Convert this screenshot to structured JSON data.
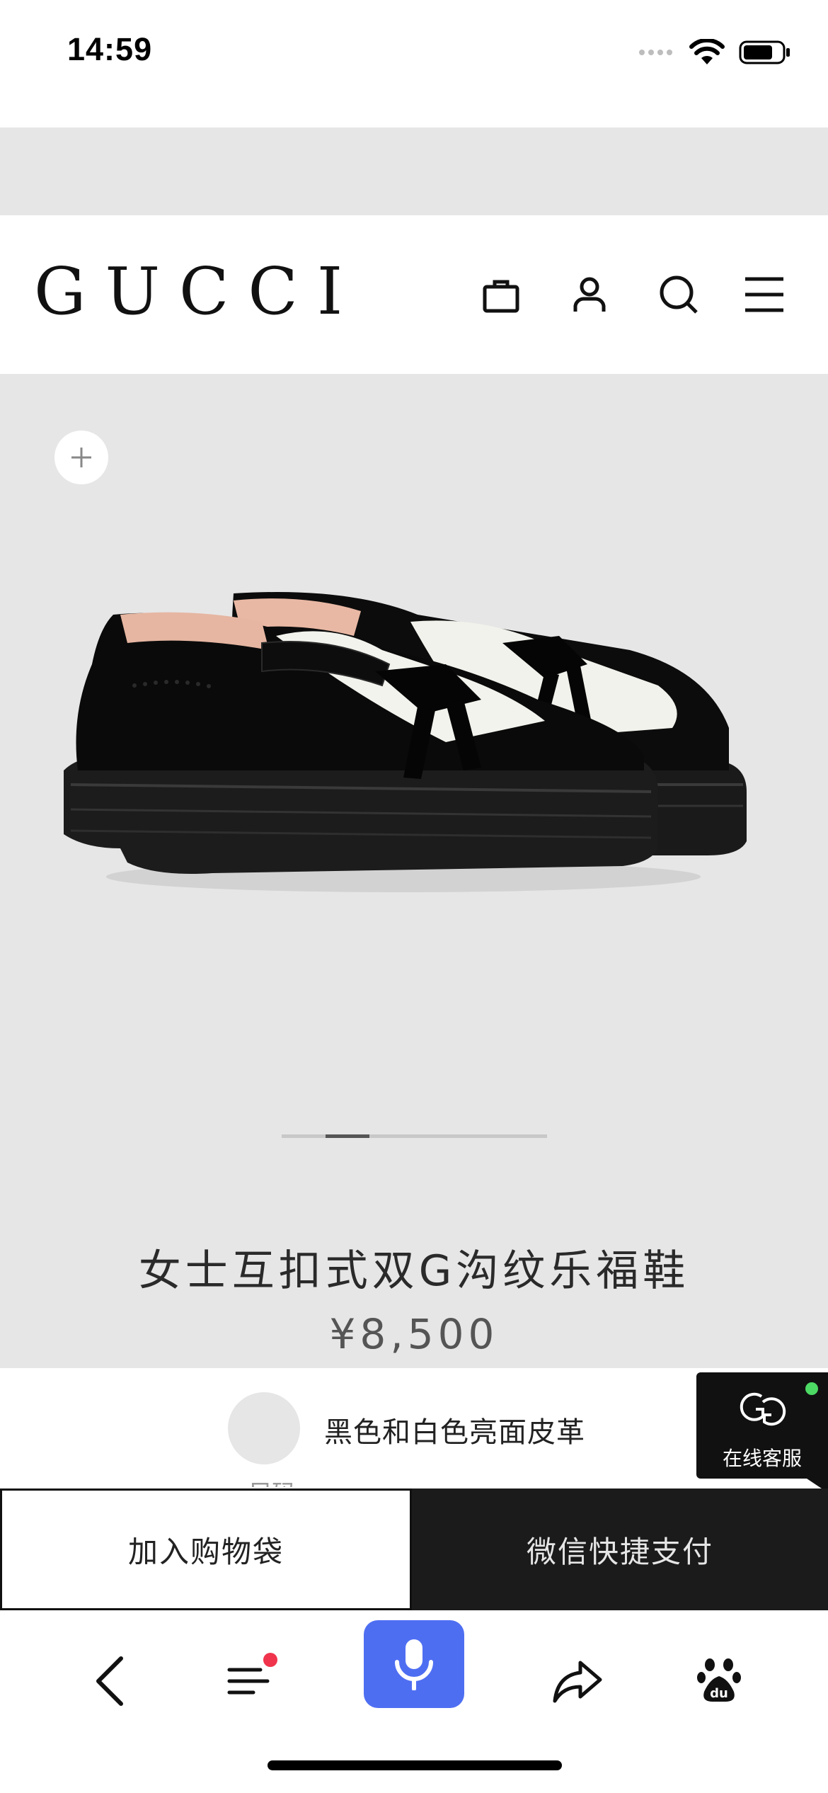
{
  "status_bar": {
    "time": "14:59"
  },
  "header": {
    "logo": "GUCCI",
    "icons": [
      "shopping-bag-icon",
      "user-icon",
      "search-icon",
      "menu-icon"
    ]
  },
  "product": {
    "title": "女士互扣式双G沟纹乐福鞋",
    "price": "¥8,500",
    "carousel": {
      "active_index": 1,
      "total": 6
    },
    "color_label": "黑色和白色亮面皮革",
    "partial_text": "尺码"
  },
  "chat_widget": {
    "label": "在线客服",
    "status_color": "#4cd964"
  },
  "actions": {
    "add_to_bag": "加入购物袋",
    "wechat_pay": "微信快捷支付"
  },
  "browser_toolbar": {
    "icons": [
      "back-icon",
      "menu-list-icon",
      "microphone-icon",
      "share-icon",
      "baidu-paw-icon"
    ],
    "accent_color": "#4e6ef2",
    "badge_color": "#f0344c"
  }
}
